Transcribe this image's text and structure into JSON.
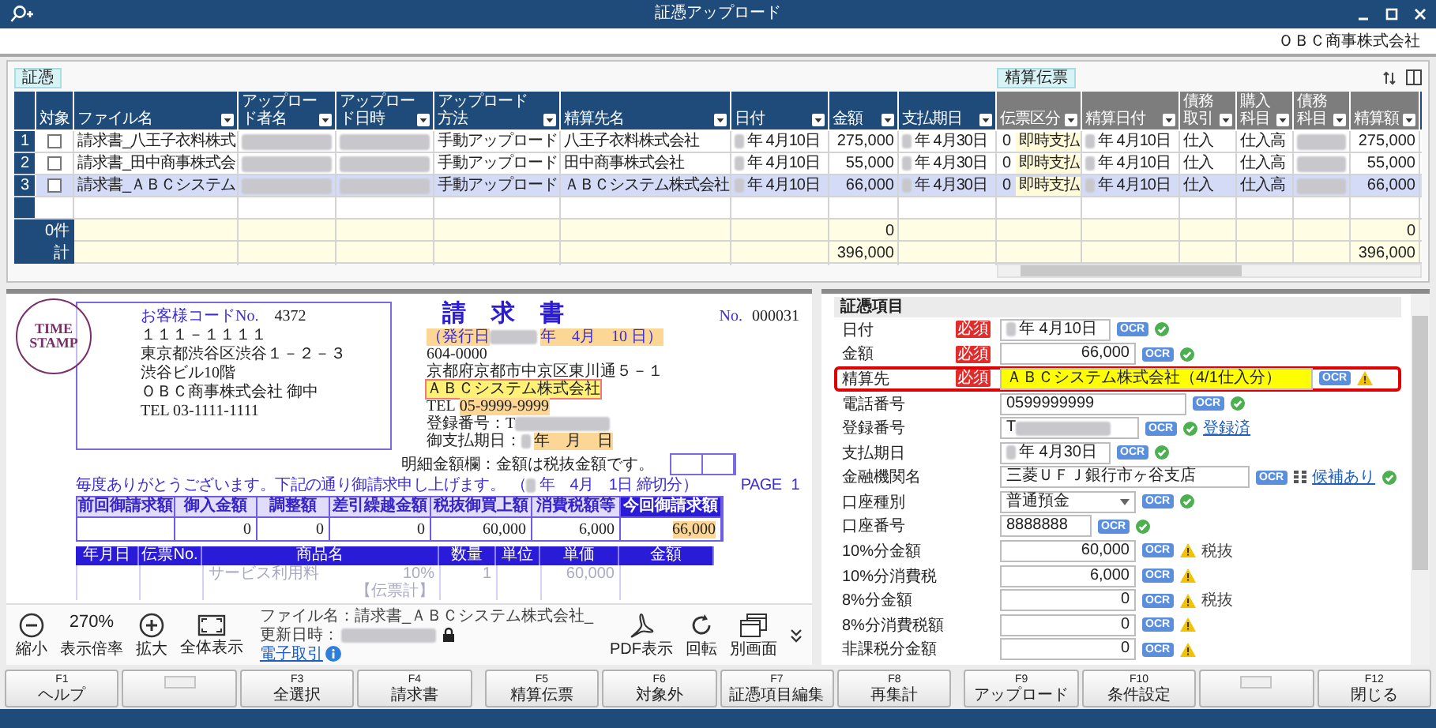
{
  "window": {
    "title": "証憑アップロード",
    "company": "ＯＢＣ商事株式会社"
  },
  "grid": {
    "evidence_label": "証憑",
    "journal_label": "精算伝票",
    "columns": [
      {
        "label": "対象",
        "kind": "check",
        "journal": false,
        "filter": false
      },
      {
        "label": "ファイル名",
        "kind": "text",
        "journal": false,
        "filter": true
      },
      {
        "label": "アップロード者名",
        "kind": "text",
        "journal": false,
        "filter": true
      },
      {
        "label": "アップロード日時",
        "kind": "text",
        "journal": false,
        "filter": true
      },
      {
        "label": "アップロード方法",
        "kind": "text",
        "journal": false,
        "filter": true
      },
      {
        "label": "精算先名",
        "kind": "text",
        "journal": false,
        "filter": true
      },
      {
        "label": "日付",
        "kind": "date",
        "journal": false,
        "filter": true
      },
      {
        "label": "金額",
        "kind": "number",
        "journal": false,
        "filter": true,
        "totaled": true
      },
      {
        "label": "支払期日",
        "kind": "date",
        "journal": false,
        "filter": true
      },
      {
        "label": "伝票区分",
        "kind": "pair",
        "journal": true,
        "filter": true
      },
      {
        "label": "精算日付",
        "kind": "date",
        "journal": true,
        "filter": true
      },
      {
        "label": "債務取引",
        "kind": "text",
        "journal": true,
        "filter": true
      },
      {
        "label": "購入科目",
        "kind": "text",
        "journal": true,
        "filter": true
      },
      {
        "label": "債務科目",
        "kind": "text",
        "journal": true,
        "filter": true
      },
      {
        "label": "精算額",
        "kind": "number",
        "journal": true,
        "filter": true,
        "totaled": true
      }
    ],
    "rows": [
      {
        "number": "1",
        "selected": false,
        "checked": false,
        "cells": [
          null,
          "請求書_八王子衣料株式",
          null,
          null,
          "手動アップロード",
          "八王子衣料株式会社",
          "年 4月10日",
          "275,000",
          "年 4月30日",
          [
            "0",
            "即時支払"
          ],
          "年 4月10日",
          "仕入",
          "仕入高",
          null,
          "275,000"
        ]
      },
      {
        "number": "2",
        "selected": false,
        "checked": false,
        "cells": [
          null,
          "請求書_田中商事株式会",
          null,
          null,
          "手動アップロード",
          "田中商事株式会社",
          "年 4月10日",
          "55,000",
          "年 4月30日",
          [
            "0",
            "即時支払"
          ],
          "年 4月10日",
          "仕入",
          "仕入高",
          null,
          "55,000"
        ]
      },
      {
        "number": "3",
        "selected": true,
        "checked": false,
        "cells": [
          null,
          "請求書_ＡＢＣシステム",
          null,
          null,
          "手動アップロード",
          "ＡＢＣシステム株式会社",
          "年 4月10日",
          "66,000",
          "年 4月30日",
          [
            "0",
            "即時支払"
          ],
          "年 4月10日",
          "仕入",
          "仕入高",
          null,
          "66,000"
        ]
      }
    ],
    "totals": [
      {
        "label": "0件",
        "values": [
          "0",
          "0"
        ]
      },
      {
        "label": "計",
        "values": [
          "396,000",
          "396,000"
        ]
      }
    ]
  },
  "viewer": {
    "invoice": {
      "customer_code_label": "お客様コードNo.",
      "customer_code": "4372",
      "stamp": "TIME STAMP",
      "recipient_lines": [
        "１１１－１１１１",
        "東京都渋谷区渋谷１－２－３",
        "渋谷ビル10階",
        "ＯＢＣ商事株式会社 御中",
        "TEL 03-1111-1111"
      ],
      "title": "請求書",
      "number_label": "No.",
      "number": "000031",
      "issue_date": {
        "prefix": "（発行日",
        "text": "年　4月　10 日）",
        "marked": true
      },
      "postal_code": "604-0000",
      "address": "京都府京都市中京区東川通５－１",
      "issuer_name": {
        "text": "ＡＢＣシステム株式会社",
        "marked": true,
        "selected": true
      },
      "tel_label": "TEL",
      "tel": {
        "text": "05-9999-9999",
        "marked": true
      },
      "registration_label": "登録番号：T",
      "due_date": {
        "label": "御支払期日：",
        "text": "年　月　日",
        "marked": true
      },
      "note": "明細金額欄：金額は税抜金額です。",
      "greeting": "毎度ありがとうございます。下記の通り御請求申し上げます。",
      "period": {
        "prefix": "（",
        "text": "年　4月　1日 締切分）"
      },
      "page_label": "PAGE",
      "page": "1",
      "summary": [
        {
          "label": "前回御請求額",
          "highlighted": false
        },
        {
          "label": "御入金額",
          "value": "0",
          "highlighted": false
        },
        {
          "label": "調整額",
          "value": "0",
          "highlighted": false
        },
        {
          "label": "差引繰越金額",
          "value": "0",
          "highlighted": false
        },
        {
          "label": "税抜御買上額",
          "value": "60,000",
          "highlighted": false
        },
        {
          "label": "消費税額等",
          "value": "6,000",
          "highlighted": false
        },
        {
          "label": "今回御請求額",
          "value": "66,000",
          "highlighted": true
        }
      ],
      "detail_columns": [
        "年月日",
        "伝票No.",
        "商品名",
        "数量",
        "単位",
        "単価",
        "金額"
      ],
      "detail_rows": [
        {
          "product": "サービス利用料",
          "tax": "10%",
          "quantity": "1",
          "price": "60,000"
        }
      ],
      "detail_total_label": "【伝票計】"
    },
    "tools_left": [
      {
        "kind": "zoom_out",
        "label": "縮小"
      },
      {
        "kind": "zoom_level",
        "value": "270%",
        "label": "表示倍率"
      },
      {
        "kind": "zoom_in",
        "label": "拡大"
      },
      {
        "kind": "fit",
        "label": "全体表示"
      }
    ],
    "file_info": {
      "file_name": "ファイル名：請求書_ＡＢＣシステム株式会社_",
      "updated_label": "更新日時：",
      "link": "電子取引"
    },
    "tools_right": [
      {
        "kind": "pdf",
        "label": "PDF表示"
      },
      {
        "kind": "rotate",
        "label": "回転"
      },
      {
        "kind": "new_window",
        "label": "別画面"
      },
      {
        "kind": "collapse"
      }
    ]
  },
  "evidence_form": {
    "title": "証憑項目",
    "fields": [
      {
        "label": "日付",
        "required": "必須",
        "kind": "date",
        "value": "年 4月10日",
        "ocr": "OCR",
        "warning": false,
        "highlighted": false
      },
      {
        "label": "金額",
        "required": "必須",
        "kind": "amount",
        "value": "66,000",
        "ocr": "OCR",
        "warning": false,
        "highlighted": false
      },
      {
        "label": "精算先",
        "required": "必須",
        "kind": "payee",
        "value": "ＡＢＣシステム株式会社（4/1仕入分）",
        "ocr": "OCR",
        "warning": true,
        "highlighted": true
      },
      {
        "label": "電話番号",
        "kind": "phone",
        "value": "0599999999",
        "ocr": "OCR",
        "warning": false,
        "highlighted": false
      },
      {
        "label": "登録番号",
        "kind": "regno",
        "value": "T",
        "ocr": "OCR",
        "warning": false,
        "link": "登録済",
        "highlighted": false
      },
      {
        "label": "支払期日",
        "kind": "date",
        "value": "年 4月30日",
        "ocr": "OCR",
        "warning": false,
        "highlighted": false
      },
      {
        "label": "金融機関名",
        "kind": "bank",
        "value": "三菱ＵＦＪ銀行市ヶ谷支店",
        "ocr": "OCR",
        "warning": false,
        "link": "候補あり",
        "highlighted": false
      },
      {
        "label": "口座種別",
        "kind": "select",
        "value": "普通預金",
        "ocr": "OCR",
        "warning": false,
        "highlighted": false
      },
      {
        "label": "口座番号",
        "kind": "account",
        "value": "8888888",
        "ocr": "OCR",
        "warning": false,
        "highlighted": false
      },
      {
        "label": "10%分金額",
        "kind": "amount",
        "value": "60,000",
        "ocr": "OCR",
        "warning": true,
        "note": "税抜",
        "highlighted": false
      },
      {
        "label": "10%分消費税",
        "kind": "amount",
        "value": "6,000",
        "ocr": "OCR",
        "warning": true,
        "highlighted": false
      },
      {
        "label": "8%分金額",
        "kind": "amount",
        "value": "0",
        "ocr": "OCR",
        "warning": true,
        "note": "税抜",
        "highlighted": false
      },
      {
        "label": "8%分消費税額",
        "kind": "amount",
        "value": "0",
        "ocr": "OCR",
        "warning": true,
        "highlighted": false
      },
      {
        "label": "非課税分金額",
        "kind": "amount",
        "value": "0",
        "ocr": "OCR",
        "warning": true,
        "highlighted": false
      }
    ]
  },
  "function_keys": [
    {
      "key": "F1",
      "label": "ヘルプ",
      "disabled": false
    },
    {
      "disabled": true
    },
    {
      "key": "F3",
      "label": "全選択",
      "disabled": false
    },
    {
      "key": "F4",
      "label": "請求書",
      "disabled": false
    },
    {
      "key": "F5",
      "label": "精算伝票",
      "disabled": false
    },
    {
      "key": "F6",
      "label": "対象外",
      "disabled": false
    },
    {
      "key": "F7",
      "label": "証憑項目編集",
      "disabled": false
    },
    {
      "key": "F8",
      "label": "再集計",
      "disabled": false
    },
    {
      "key": "F9",
      "label": "アップロード",
      "disabled": false
    },
    {
      "key": "F10",
      "label": "条件設定",
      "disabled": false
    },
    {
      "disabled": true
    },
    {
      "key": "F12",
      "label": "閉じる",
      "disabled": false
    }
  ]
}
